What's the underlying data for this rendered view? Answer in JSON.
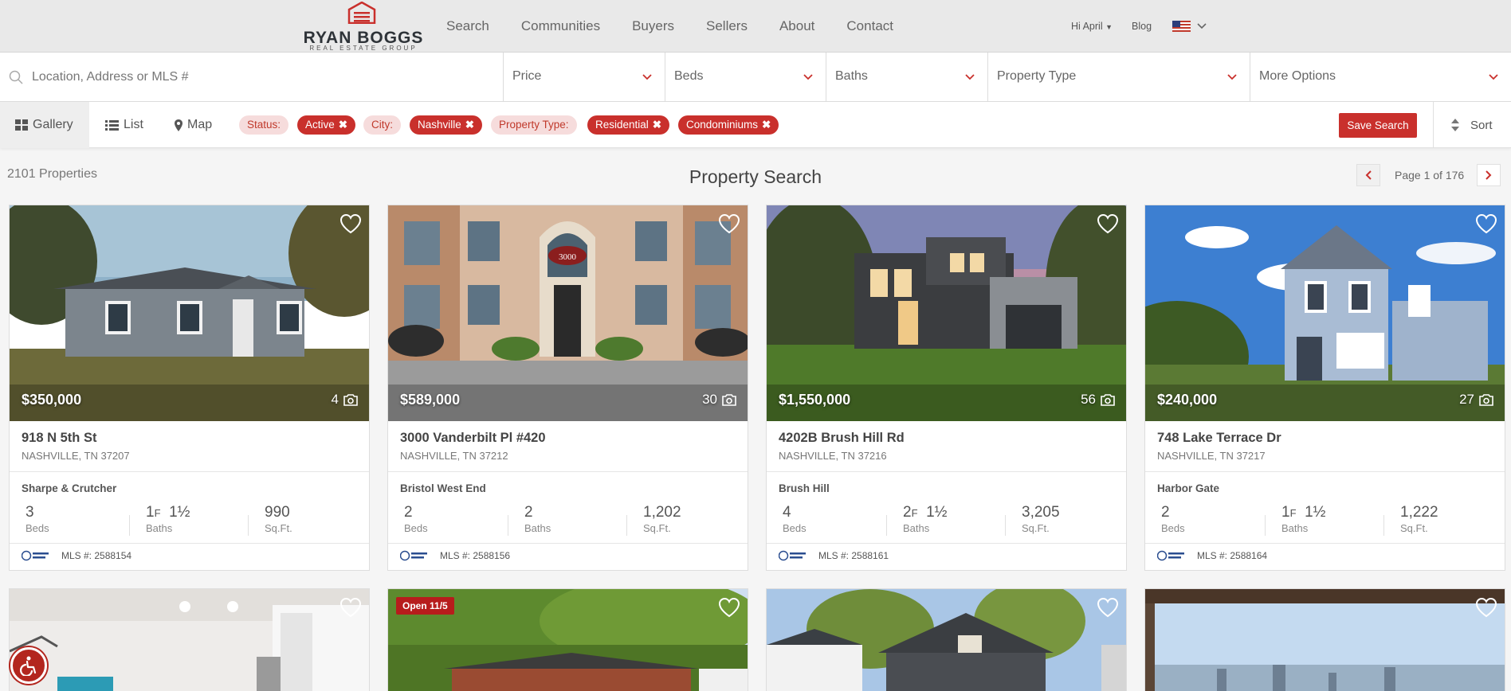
{
  "brand": {
    "name": "RYAN BOGGS",
    "subtitle": "REAL ESTATE GROUP"
  },
  "nav": {
    "links": [
      "Search",
      "Communities",
      "Buyers",
      "Sellers",
      "About",
      "Contact"
    ],
    "user": "Hi April",
    "blog": "Blog",
    "locale": "us-flag-icon"
  },
  "search": {
    "placeholder": "Location, Address or MLS #",
    "price": "Price",
    "beds": "Beds",
    "baths": "Baths",
    "property_type": "Property Type",
    "more": "More Options"
  },
  "views": {
    "gallery": "Gallery",
    "list": "List",
    "map": "Map",
    "active": "Gallery"
  },
  "filters": {
    "status_label": "Status:",
    "status": [
      "Active"
    ],
    "city_label": "City:",
    "city": [
      "Nashville"
    ],
    "type_label": "Property Type:",
    "types": [
      "Residential",
      "Condominiums"
    ]
  },
  "save_search": "Save Search",
  "sort": "Sort",
  "results": {
    "count": "2101 Properties",
    "title": "Property Search",
    "page": "Page 1 of 176"
  },
  "listings": [
    {
      "price": "$350,000",
      "photos": "4",
      "address": "918 N 5th St",
      "city": "NASHVILLE, TN 37207",
      "hood": "Sharpe & Crutcher",
      "beds": "3",
      "baths_full": "1",
      "baths_half": "1",
      "sqft": "990",
      "mls": "MLS #: 2588154"
    },
    {
      "price": "$589,000",
      "photos": "30",
      "address": "3000 Vanderbilt Pl #420",
      "city": "NASHVILLE, TN 37212",
      "hood": "Bristol West End",
      "beds": "2",
      "baths_full": "2",
      "baths_half": "",
      "sqft": "1,202",
      "mls": "MLS #: 2588156",
      "sign": "3000"
    },
    {
      "price": "$1,550,000",
      "photos": "56",
      "address": "4202B Brush Hill Rd",
      "city": "NASHVILLE, TN 37216",
      "hood": "Brush Hill",
      "beds": "4",
      "baths_full": "2",
      "baths_half": "1",
      "sqft": "3,205",
      "mls": "MLS #: 2588161"
    },
    {
      "price": "$240,000",
      "photos": "27",
      "address": "748 Lake Terrace Dr",
      "city": "NASHVILLE, TN 37217",
      "hood": "Harbor Gate",
      "beds": "2",
      "baths_full": "1",
      "baths_half": "1",
      "sqft": "1,222",
      "mls": "MLS #: 2588164"
    }
  ],
  "labels": {
    "beds": "Beds",
    "baths": "Baths",
    "sqft": "Sq.Ft.",
    "full": "F",
    "half": "½"
  },
  "second_row": {
    "open_badge": "Open 11/5"
  },
  "colors": {
    "accent": "#c9302c",
    "chip_light": "#f6dcdc",
    "header_bg": "#e9e9e9"
  }
}
